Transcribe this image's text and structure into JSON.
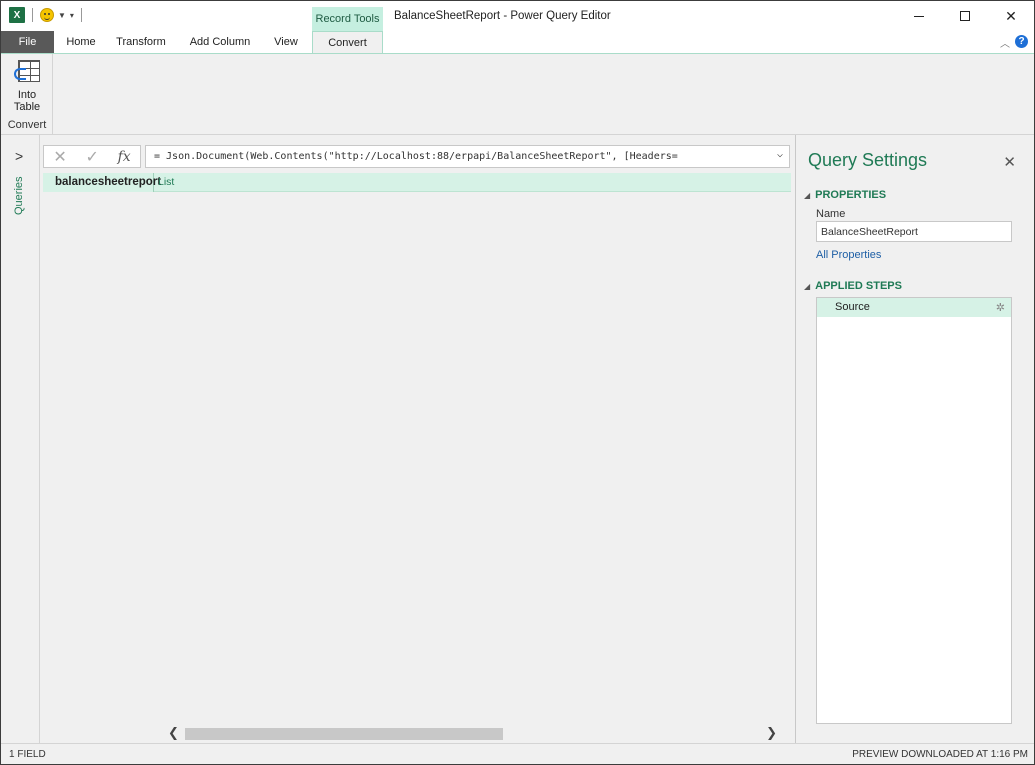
{
  "window": {
    "title": "BalanceSheetReport - Power Query Editor",
    "context_tab_group": "Record Tools",
    "excel_icon_text": "X"
  },
  "tabs": [
    {
      "label": "File"
    },
    {
      "label": "Home"
    },
    {
      "label": "Transform"
    },
    {
      "label": "Add Column"
    },
    {
      "label": "View"
    },
    {
      "label": "Convert",
      "active": true
    }
  ],
  "ribbon": {
    "into_table_line1": "Into",
    "into_table_line2": "Table",
    "group_label": "Convert"
  },
  "queries_pane": {
    "label": "Queries"
  },
  "formula_bar": {
    "formula": "= Json.Document(Web.Contents(\"http://Localhost:88/erpapi/BalanceSheetReport\", [Headers=",
    "fx_label": "fx"
  },
  "grid": {
    "column_header": "balancesheetreport",
    "value": "List"
  },
  "settings": {
    "title": "Query Settings",
    "properties_heading": "PROPERTIES",
    "name_label": "Name",
    "name_value": "BalanceSheetReport",
    "all_properties_link": "All Properties",
    "applied_steps_heading": "APPLIED STEPS",
    "steps": [
      {
        "label": "Source"
      }
    ]
  },
  "status": {
    "left": "1 FIELD",
    "right": "PREVIEW DOWNLOADED AT 1:16 PM"
  },
  "colors": {
    "accent_green": "#1f7a55",
    "selection_green": "#d6f2e6",
    "record_tools_bg": "#c5efe0",
    "file_tab_bg": "#595959"
  }
}
